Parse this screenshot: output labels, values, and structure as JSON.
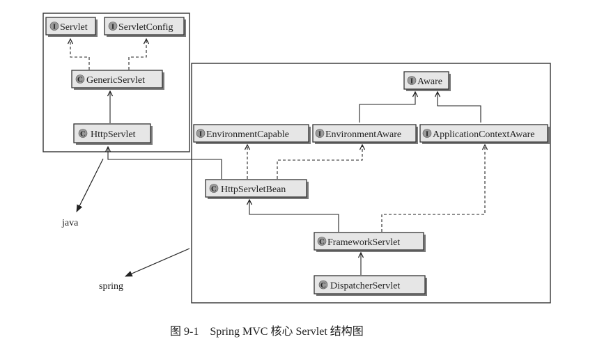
{
  "nodes": {
    "servlet": {
      "badge": "I",
      "label": "Servlet"
    },
    "servlet_config": {
      "badge": "I",
      "label": "ServletConfig"
    },
    "generic_servlet": {
      "badge": "C",
      "label": "GenericServlet"
    },
    "http_servlet": {
      "badge": "C",
      "label": "HttpServlet"
    },
    "aware": {
      "badge": "I",
      "label": "Aware"
    },
    "environment_capable": {
      "badge": "I",
      "label": "EnvironmentCapable"
    },
    "environment_aware": {
      "badge": "I",
      "label": "EnvironmentAware"
    },
    "application_context_aware": {
      "badge": "I",
      "label": "ApplicationContextAware"
    },
    "http_servlet_bean": {
      "badge": "C",
      "label": "HttpServletBean"
    },
    "framework_servlet": {
      "badge": "C",
      "label": "FrameworkServlet"
    },
    "dispatcher_servlet": {
      "badge": "C",
      "label": "DispatcherServlet"
    }
  },
  "packages": {
    "java": "java",
    "spring": "spring"
  },
  "caption": "图 9-1　Spring MVC 核心 Servlet 结构图"
}
